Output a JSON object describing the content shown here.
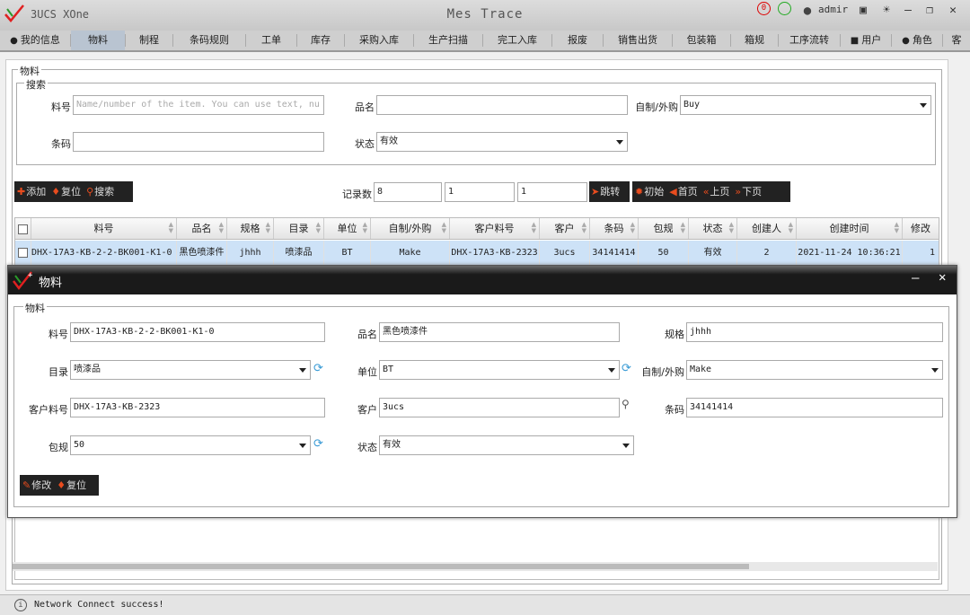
{
  "window": {
    "app_title": "3UCS XOne",
    "center_title": "Mes Trace",
    "user": "admir",
    "alert_count": "0"
  },
  "nav": [
    {
      "label": "我的信息",
      "icon": "user-icon"
    },
    {
      "label": "物料",
      "active": true
    },
    {
      "label": "制程"
    },
    {
      "label": "条码规则"
    },
    {
      "label": "工单"
    },
    {
      "label": "库存"
    },
    {
      "label": "采购入库"
    },
    {
      "label": "生产扫描"
    },
    {
      "label": "完工入库"
    },
    {
      "label": "报废"
    },
    {
      "label": "销售出货"
    },
    {
      "label": "包装箱"
    },
    {
      "label": "箱规"
    },
    {
      "label": "工序流转"
    },
    {
      "label": "用户",
      "icon": "users-icon"
    },
    {
      "label": "角色",
      "icon": "role-icon"
    },
    {
      "label": "客"
    }
  ],
  "main": {
    "group_title": "物料",
    "search": {
      "title": "搜索",
      "part_label": "料号",
      "part_placeholder": "Name/number of the item. You can use text, nu",
      "name_label": "品名",
      "name_value": "",
      "make_label": "自制/外购",
      "make_value": "Buy",
      "barcode_label": "条码",
      "barcode_value": "",
      "state_label": "状态",
      "state_value": "有效"
    },
    "toolbar": {
      "add": "添加",
      "reset": "复位",
      "search": "搜索"
    },
    "pager": {
      "count_label": "记录数",
      "count_value": "8",
      "page_value": "1",
      "page_total": "1",
      "jump": "跳转",
      "init": "初始",
      "first": "首页",
      "prev": "上页",
      "next": "下页"
    },
    "table": {
      "headers": [
        "料号",
        "品名",
        "规格",
        "目录",
        "单位",
        "自制/外购",
        "客户料号",
        "客户",
        "条码",
        "包规",
        "状态",
        "创建人",
        "创建时间",
        "修改"
      ],
      "rows": [
        [
          "DHX-17A3-KB-2-2-BK001-K1-0",
          "黑色喷漆件",
          "jhhh",
          "喷漆品",
          "BT",
          "Make",
          "DHX-17A3-KB-2323",
          "3ucs",
          "34141414",
          "50",
          "有效",
          "2",
          "2021-11-24 10:36:21",
          "1"
        ]
      ]
    }
  },
  "dialog": {
    "title": "物料",
    "group_title": "物料",
    "part_label": "料号",
    "part_value": "DHX-17A3-KB-2-2-BK001-K1-0",
    "name_label": "品名",
    "name_value": "黑色喷漆件",
    "spec_label": "规格",
    "spec_value": "jhhh",
    "catalog_label": "目录",
    "catalog_value": "喷漆品",
    "unit_label": "单位",
    "unit_value": "BT",
    "make_label": "自制/外购",
    "make_value": "Make",
    "custpart_label": "客户料号",
    "custpart_value": "DHX-17A3-KB-2323",
    "cust_label": "客户",
    "cust_value": "3ucs",
    "barcode_label": "条码",
    "barcode_value": "34141414",
    "pack_label": "包规",
    "pack_value": "50",
    "state_label": "状态",
    "state_value": "有效",
    "edit": "修改",
    "reset": "复位"
  },
  "status": {
    "text": "Network Connect success!"
  },
  "colors": {
    "accent": "#e84c1e",
    "row_selected": "#cde2f7",
    "dialog_title": "#1a1a1a"
  }
}
